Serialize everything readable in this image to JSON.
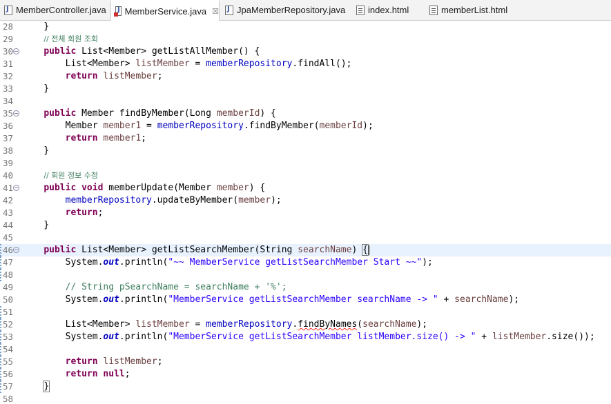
{
  "tabs": [
    {
      "label": "MemberController.java",
      "icon": "java-file-icon",
      "active": false
    },
    {
      "label": "MemberService.java",
      "icon": "java-file-error-icon",
      "active": true,
      "close": "☒"
    },
    {
      "label": "JpaMemberRepository.java",
      "icon": "java-file-icon",
      "active": false
    },
    {
      "label": "index.html",
      "icon": "html-file-icon",
      "active": false
    },
    {
      "label": "memberList.html",
      "icon": "html-file-icon",
      "active": false
    }
  ],
  "line_numbers": [
    "28",
    "29",
    "30",
    "31",
    "32",
    "33",
    "34",
    "35",
    "36",
    "37",
    "38",
    "39",
    "40",
    "41",
    "42",
    "43",
    "44",
    "45",
    "46",
    "47",
    "48",
    "49",
    "50",
    "51",
    "52",
    "53",
    "54",
    "55",
    "56",
    "57",
    "58"
  ],
  "code": {
    "c29": "// 전체 회원 조회",
    "c40": "// 회원 정보 수정",
    "c49": "// String pSearchName = searchName + '%';",
    "s47": "\"~~ MemberService getListSearchMember Start ~~\"",
    "s50": "\"MemberService getListSearchMember searchName -> \"",
    "s53": "\"MemberService getListSearchMember listMember.size() -> \""
  }
}
